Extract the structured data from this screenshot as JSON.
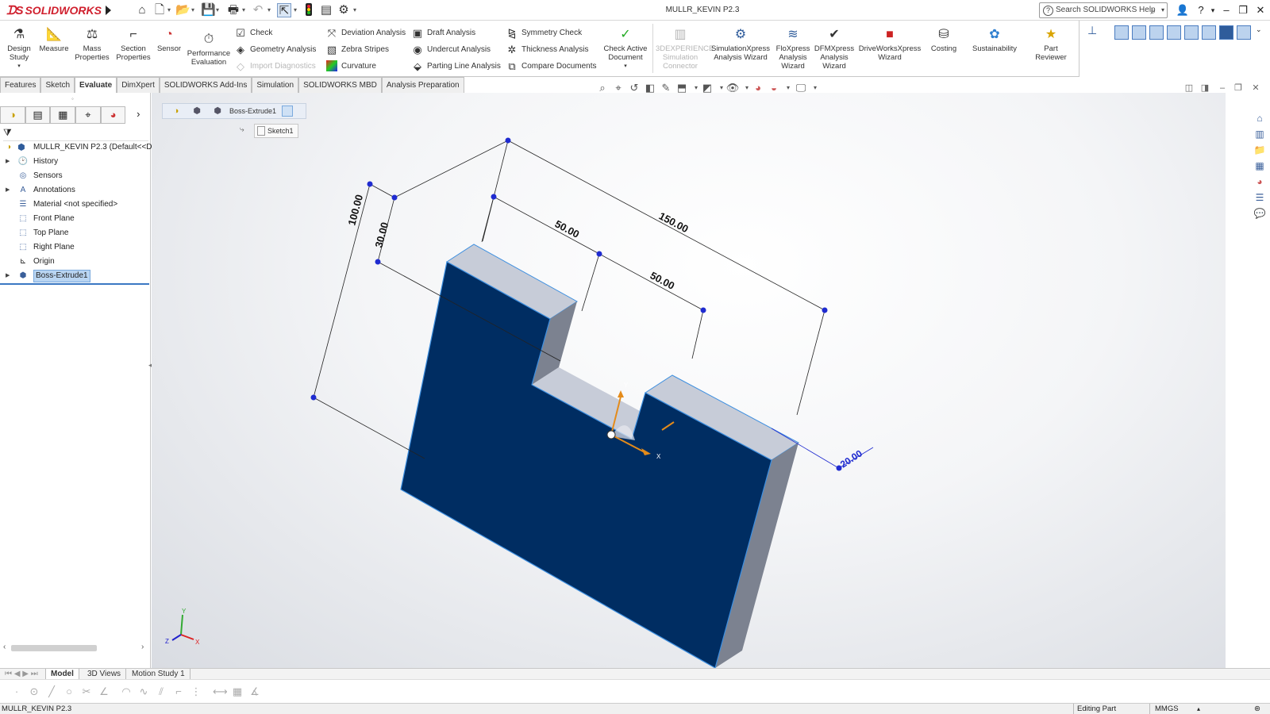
{
  "app": {
    "brand": "SOLIDWORKS",
    "window_title": "MULLR_KEVIN P2.3",
    "search_placeholder": "Search SOLIDWORKS Help"
  },
  "colors": {
    "brand_red": "#d0202e",
    "model_front": "#002d62",
    "model_top": "#c7ccd8",
    "model_side": "#7c8290",
    "edge_highlight": "#3d8fe0",
    "dimension_point": "#1f2bd0",
    "selection": "#b9d5f2"
  },
  "ribbon": {
    "large_buttons": [
      {
        "id": "design-study",
        "label": "Design Study",
        "icon": "design-study-icon"
      },
      {
        "id": "measure",
        "label": "Measure",
        "icon": "measure-icon"
      },
      {
        "id": "mass-properties",
        "label": "Mass Properties",
        "icon": "mass-properties-icon"
      },
      {
        "id": "section-properties",
        "label": "Section Properties",
        "icon": "section-properties-icon"
      },
      {
        "id": "sensor",
        "label": "Sensor",
        "icon": "sensor-icon"
      },
      {
        "id": "performance-evaluation",
        "label": "Performance Evaluation",
        "icon": "performance-icon"
      }
    ],
    "small_col1": [
      "Check",
      "Geometry Analysis",
      "Import Diagnostics"
    ],
    "small_col2": [
      "Deviation Analysis",
      "Zebra Stripes",
      "Curvature"
    ],
    "small_col3": [
      "Draft Analysis",
      "Undercut Analysis",
      "Parting Line Analysis"
    ],
    "small_col4": [
      "Symmetry Check",
      "Thickness Analysis",
      "Compare Documents"
    ],
    "check_active": "Check Active Document",
    "right_buttons": [
      {
        "id": "3dexperience",
        "label": "3DEXPERIENCE Simulation Connector",
        "disabled": true
      },
      {
        "id": "simulationxpress",
        "label": "SimulationXpress Analysis Wizard"
      },
      {
        "id": "floxpress",
        "label": "FloXpress Analysis Wizard"
      },
      {
        "id": "dfmxpress",
        "label": "DFMXpress Analysis Wizard"
      },
      {
        "id": "driveworksxpress",
        "label": "DriveWorksXpress Wizard"
      },
      {
        "id": "costing",
        "label": "Costing"
      },
      {
        "id": "sustainability",
        "label": "Sustainability"
      },
      {
        "id": "part-reviewer",
        "label": "Part Reviewer"
      }
    ]
  },
  "tabs": [
    "Features",
    "Sketch",
    "Evaluate",
    "DimXpert",
    "SOLIDWORKS Add-Ins",
    "Simulation",
    "SOLIDWORKS MBD",
    "Analysis Preparation"
  ],
  "active_tab": "Evaluate",
  "tree": {
    "root": "MULLR_KEVIN P2.3  (Default<<De",
    "items": [
      {
        "label": "History",
        "icon": "history-icon",
        "expandable": true
      },
      {
        "label": "Sensors",
        "icon": "sensors-icon",
        "expandable": false
      },
      {
        "label": "Annotations",
        "icon": "annotations-icon",
        "expandable": true
      },
      {
        "label": "Material <not specified>",
        "icon": "material-icon",
        "expandable": false
      },
      {
        "label": "Front Plane",
        "icon": "plane-icon",
        "expandable": false
      },
      {
        "label": "Top Plane",
        "icon": "plane-icon",
        "expandable": false
      },
      {
        "label": "Right Plane",
        "icon": "plane-icon",
        "expandable": false
      },
      {
        "label": "Origin",
        "icon": "origin-icon",
        "expandable": false
      },
      {
        "label": "Boss-Extrude1",
        "icon": "extrude-icon",
        "expandable": true,
        "selected": true
      }
    ]
  },
  "breadcrumb": {
    "feature": "Boss-Extrude1",
    "sketch": "Sketch1"
  },
  "dimensions": {
    "d100": "100.00",
    "d30": "30.00",
    "d50a": "50.00",
    "d150": "150.00",
    "d50b": "50.00",
    "d20": "20.00"
  },
  "triad": {
    "x": "X",
    "y": "Y",
    "z": "Z"
  },
  "bottom_tabs": [
    "Model",
    "3D Views",
    "Motion Study 1"
  ],
  "status": {
    "file": "MULLR_KEVIN P2.3",
    "mode": "Editing Part",
    "units": "MMGS"
  }
}
